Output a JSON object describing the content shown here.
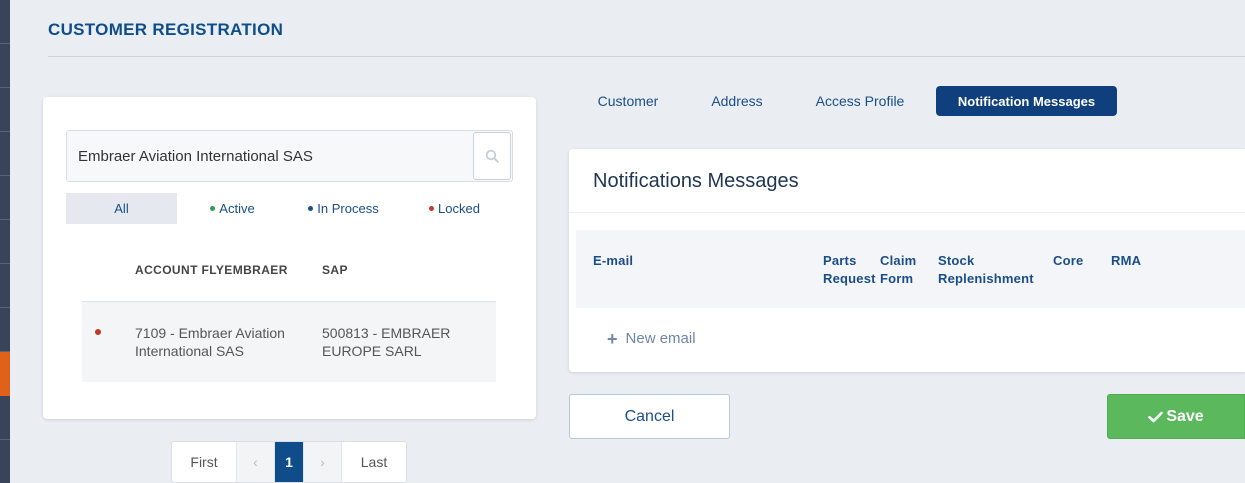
{
  "page": {
    "title": "CUSTOMER REGISTRATION"
  },
  "search": {
    "value": "Embraer Aviation International SAS",
    "icon": "search-icon"
  },
  "filters": [
    {
      "label": "All",
      "dot_color": ""
    },
    {
      "label": "Active",
      "dot_color": "#2e9e4f"
    },
    {
      "label": "In Process",
      "dot_color": "#1b4e88"
    },
    {
      "label": "Locked",
      "dot_color": "#c0392b"
    }
  ],
  "results": {
    "columns": [
      "ACCOUNT FLYEMBRAER",
      "SAP"
    ],
    "rows": [
      {
        "status_color": "#c0392b",
        "account_line1": "7109 - Embraer Aviation",
        "account_line2": "International SAS",
        "sap_line1": "500813 - EMBRAER",
        "sap_line2": "EUROPE SARL"
      }
    ]
  },
  "pagination": {
    "first": "First",
    "prev": "‹",
    "current": "1",
    "next": "›",
    "last": "Last"
  },
  "tabs": [
    {
      "label": "Customer"
    },
    {
      "label": "Address"
    },
    {
      "label": "Access Profile"
    },
    {
      "label": "Notification Messages"
    }
  ],
  "notifications": {
    "title": "Notifications Messages",
    "columns": [
      {
        "line1": "E-mail",
        "line2": ""
      },
      {
        "line1": "Parts",
        "line2": "Request"
      },
      {
        "line1": "Claim",
        "line2": "Form"
      },
      {
        "line1": "Stock",
        "line2": "Replenishment"
      },
      {
        "line1": "Core",
        "line2": ""
      },
      {
        "line1": "RMA",
        "line2": ""
      }
    ],
    "new_email_label": "New email"
  },
  "actions": {
    "cancel_label": "Cancel",
    "save_label": "Save"
  }
}
